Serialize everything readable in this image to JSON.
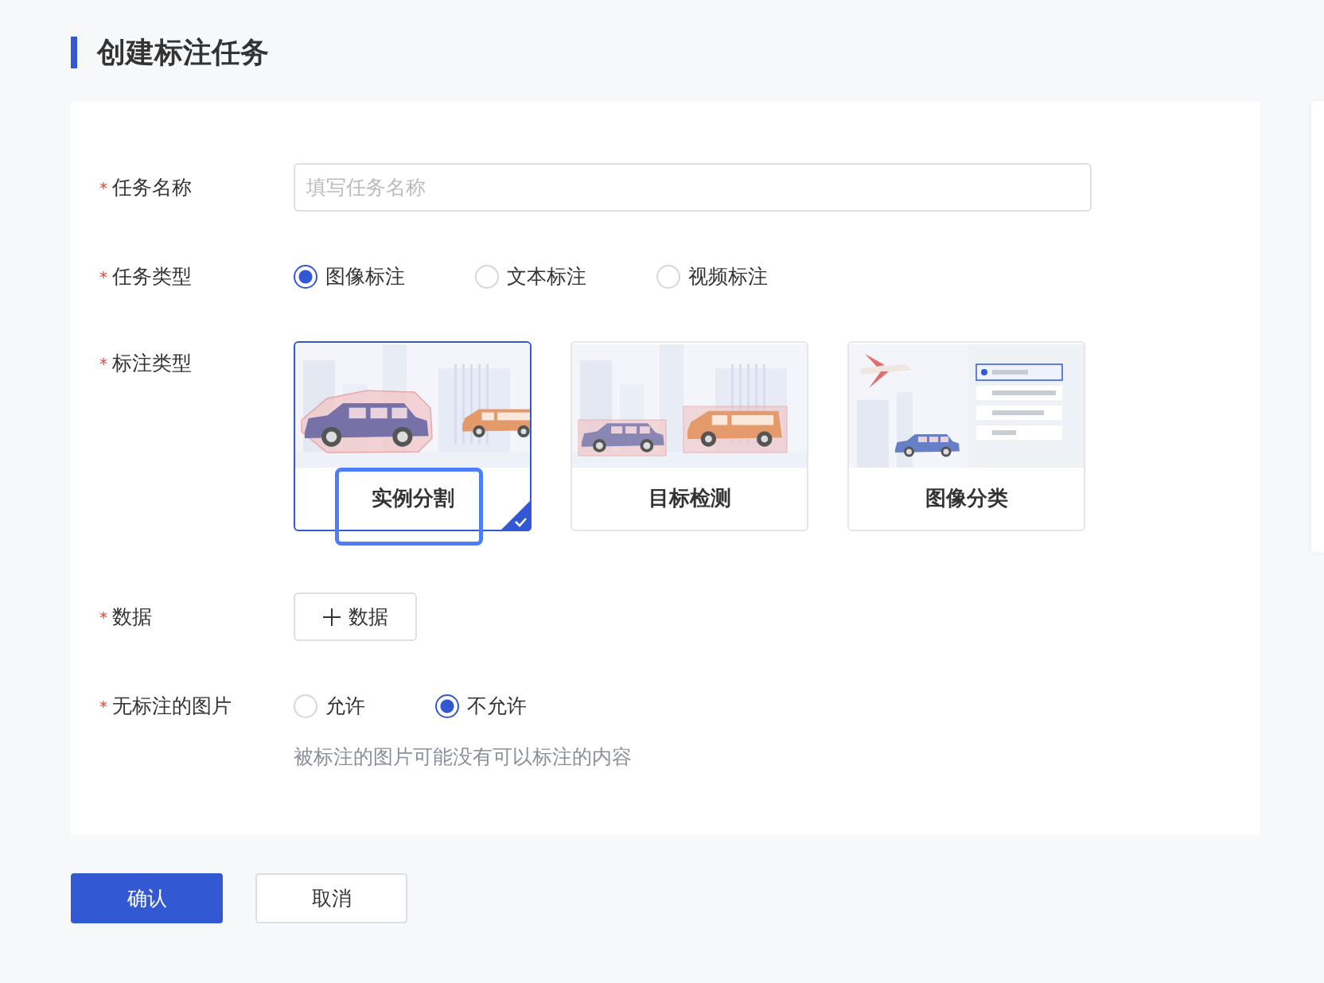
{
  "page": {
    "title": "创建标注任务"
  },
  "task_name": {
    "required_mark": "*",
    "label": "任务名称",
    "placeholder": "填写任务名称"
  },
  "task_type": {
    "required_mark": "*",
    "label": "任务类型",
    "options": [
      {
        "label": "图像标注",
        "selected": true
      },
      {
        "label": "文本标注",
        "selected": false
      },
      {
        "label": "视频标注",
        "selected": false
      }
    ]
  },
  "annotation_type": {
    "required_mark": "*",
    "label": "标注类型",
    "options": [
      {
        "label": "实例分割",
        "kind": "segmentation",
        "selected": true,
        "highlighted": true
      },
      {
        "label": "目标检测",
        "kind": "detection",
        "selected": false,
        "highlighted": false
      },
      {
        "label": "图像分类",
        "kind": "classification",
        "selected": false,
        "highlighted": false
      }
    ]
  },
  "data": {
    "required_mark": "*",
    "label": "数据",
    "button": "数据"
  },
  "unlabeled_images": {
    "required_mark": "*",
    "label": "无标注的图片",
    "options": [
      {
        "label": "允许",
        "selected": false
      },
      {
        "label": "不允许",
        "selected": true
      }
    ],
    "hint": "被标注的图片可能没有可以标注的内容"
  },
  "actions": [
    {
      "label": "确认",
      "kind": "primary"
    },
    {
      "label": "取消",
      "kind": "secondary"
    }
  ]
}
